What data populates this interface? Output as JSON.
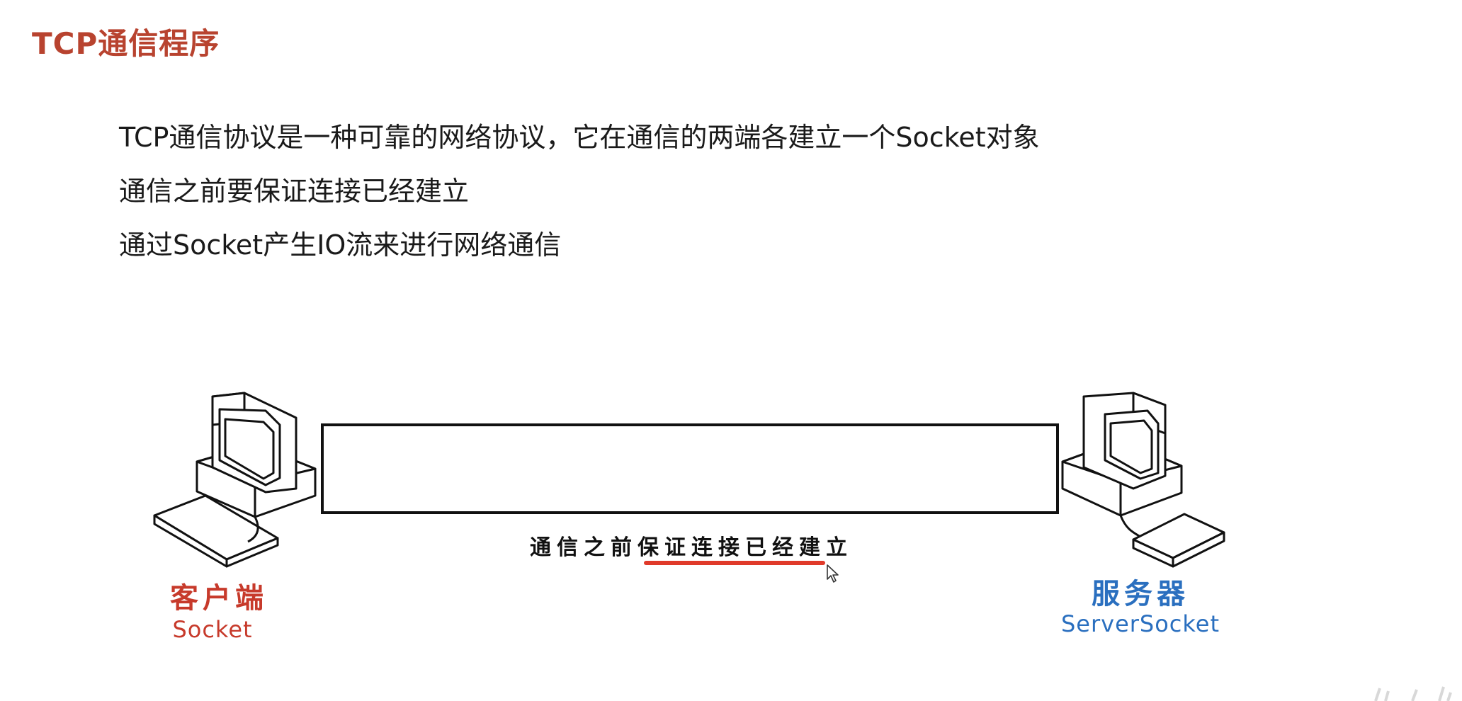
{
  "page": {
    "title": "TCP通信程序"
  },
  "bullets": [
    "TCP通信协议是一种可靠的网络协议，它在通信的两端各建立一个Socket对象",
    "通信之前要保证连接已经建立",
    "通过Socket产生IO流来进行网络通信"
  ],
  "diagram": {
    "client": {
      "name": "客户端",
      "type": "Socket",
      "icon": "computer-icon"
    },
    "server": {
      "name": "服务器",
      "type": "ServerSocket",
      "icon": "computer-icon"
    },
    "link_caption": "通信之前保证连接已经建立",
    "colors": {
      "title": "#b8432f",
      "client": "#c73a2b",
      "server": "#2a6fbf",
      "underline": "#e03a2a"
    }
  }
}
